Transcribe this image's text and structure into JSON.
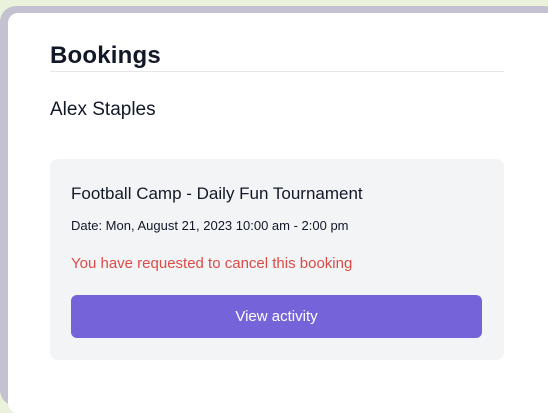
{
  "page": {
    "title": "Bookings",
    "user_name": "Alex Staples"
  },
  "booking": {
    "title": "Football Camp - Daily Fun Tournament",
    "date_text": "Date: Mon, August 21, 2023 10:00 am - 2:00 pm",
    "status_text": "You have requested to cancel this booking",
    "action_label": "View activity"
  },
  "colors": {
    "accent": "#7564d9",
    "status_warning": "#dc4b47",
    "card_background": "#f3f4f6",
    "page_background": "#eaf2dc"
  }
}
